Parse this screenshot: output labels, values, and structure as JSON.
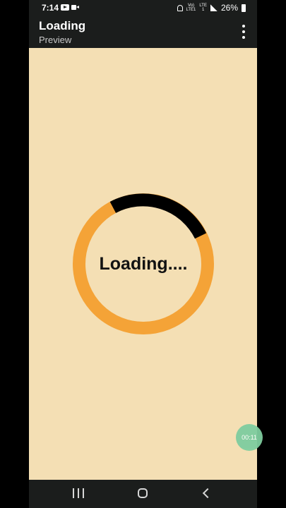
{
  "status_bar": {
    "time": "7:14",
    "network_top": "Vo)",
    "network_bottom": "LTE1",
    "network2_top": "LTE",
    "network2_bottom": "1",
    "battery_percent": "26%"
  },
  "app_bar": {
    "title": "Loading",
    "subtitle": "Preview",
    "menu_icon": "more-vertical-icon"
  },
  "loader": {
    "text": "Loading....",
    "progress_color": "#f4a337",
    "track_color": "#000000",
    "background_color": "#f4dfb4"
  },
  "timer": {
    "value": "00:11"
  },
  "nav_bar": {
    "recents_icon": "recents-icon",
    "home_icon": "home-icon",
    "back_icon": "back-icon"
  }
}
